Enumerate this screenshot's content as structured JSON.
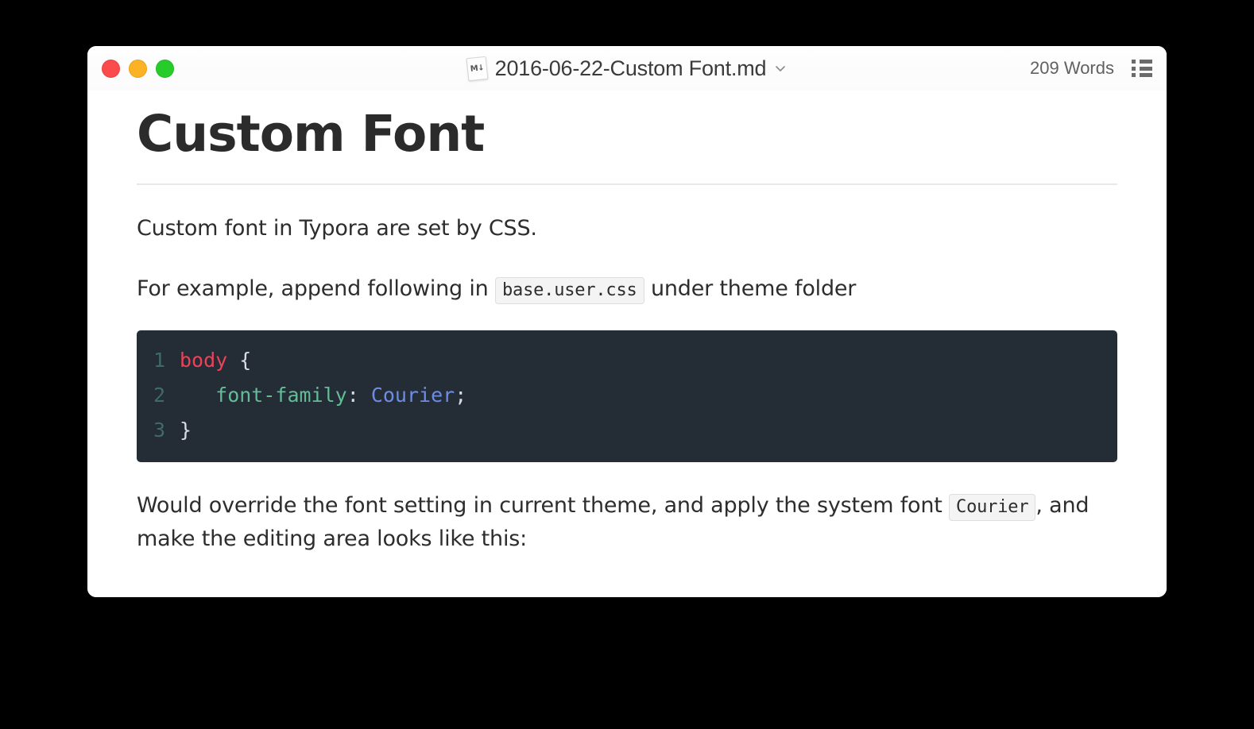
{
  "window": {
    "traffic_lights": [
      {
        "name": "close",
        "color": "#fc4b4b"
      },
      {
        "name": "minimize",
        "color": "#fbb325"
      },
      {
        "name": "zoom",
        "color": "#27cc2b"
      }
    ],
    "title": "2016-06-22-Custom Font.md",
    "file_icon_label": "M↓",
    "file_icon_name": "markdown-file-icon",
    "title_dropdown_icon": "chevron-down-icon",
    "word_count": "209 Words",
    "outline_icon": "outline-list-icon"
  },
  "document": {
    "heading": "Custom Font",
    "paragraph1": "Custom font in Typora are set by CSS.",
    "paragraph2": {
      "before_code": "For example, append following in ",
      "code": "base.user.css",
      "after_code": " under theme folder"
    },
    "code_block": {
      "language": "css",
      "lines": [
        {
          "number": "1",
          "tokens": [
            {
              "text": "body",
              "type": "selector"
            },
            {
              "text": " {",
              "type": "punctuation"
            }
          ]
        },
        {
          "number": "2",
          "tokens": [
            {
              "text": "   font-family",
              "type": "property"
            },
            {
              "text": ": ",
              "type": "punctuation"
            },
            {
              "text": "Courier",
              "type": "value"
            },
            {
              "text": ";",
              "type": "punctuation"
            }
          ]
        },
        {
          "number": "3",
          "tokens": [
            {
              "text": "}",
              "type": "punctuation"
            }
          ]
        }
      ]
    },
    "paragraph3": {
      "before_code": "Would override the font setting in current theme, and apply the system font ",
      "code": "Courier",
      "after_code": ", and make the editing area looks like this:"
    }
  },
  "colors": {
    "background": "#000000",
    "window_background": "#ffffff",
    "titlebar": "#fdfdfd",
    "text": "#2d2d2d",
    "heading": "#2b2b2b",
    "rule": "#e8e8e8",
    "inline_code_bg": "#f4f4f4",
    "inline_code_border": "#dedede",
    "code_block_bg": "#242c35",
    "code_selector": "#ef4159",
    "code_property": "#62bd97",
    "code_value": "#6d8ce6",
    "code_punctuation": "#d7dde3",
    "code_lineno": "#3f6a66"
  }
}
